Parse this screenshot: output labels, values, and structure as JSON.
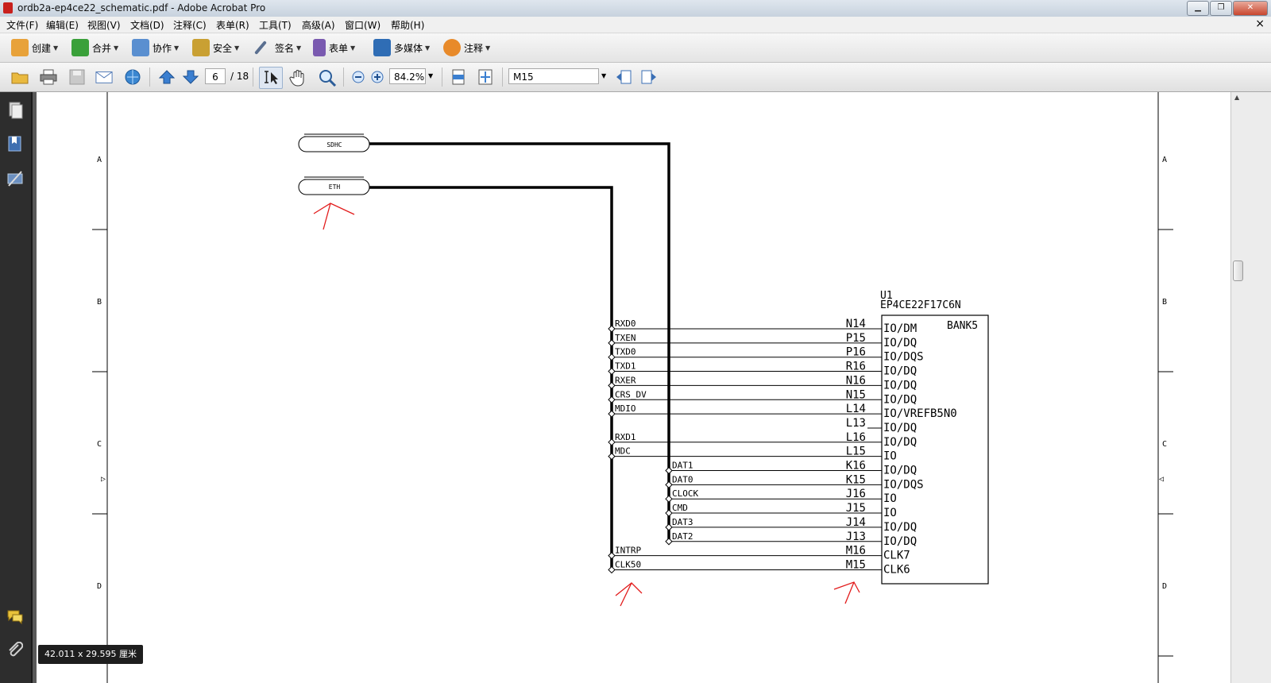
{
  "window": {
    "title": "ordb2a-ep4ce22_schematic.pdf - Adobe Acrobat Pro",
    "minimize": "▁",
    "maximize": "❐",
    "close": "✕"
  },
  "menu": {
    "items": [
      "文件(F)",
      "编辑(E)",
      "视图(V)",
      "文档(D)",
      "注释(C)",
      "表单(R)",
      "工具(T)",
      "高级(A)",
      "窗口(W)",
      "帮助(H)"
    ],
    "doc_close": "×"
  },
  "toolbar1": {
    "buttons": [
      {
        "label": "创建",
        "icon": "create-icon",
        "color": "#e8a23a"
      },
      {
        "label": "合并",
        "icon": "combine-icon",
        "color": "#3aa03a"
      },
      {
        "label": "协作",
        "icon": "collaborate-icon",
        "color": "#5a8fd0"
      },
      {
        "label": "安全",
        "icon": "lock-icon",
        "color": "#c9a033"
      },
      {
        "label": "签名",
        "icon": "pen-icon",
        "color": "#5a6f90"
      },
      {
        "label": "表单",
        "icon": "form-icon",
        "color": "#7a5ab0"
      },
      {
        "label": "多媒体",
        "icon": "multimedia-icon",
        "color": "#2f6db5"
      },
      {
        "label": "注释",
        "icon": "comment-icon",
        "color": "#e88a2a"
      }
    ]
  },
  "toolbar2": {
    "page_current": "6",
    "page_total": "/ 18",
    "zoom": "84.2%",
    "search_value": "M15"
  },
  "status": {
    "page_size": "42.011 x 29.595 厘米"
  },
  "schematic": {
    "row_markers": [
      "A",
      "B",
      "C",
      "D"
    ],
    "connectors": {
      "top": "SDHC",
      "bottom": "ETH"
    },
    "chip": {
      "ref": "U1",
      "part": "EP4CE22F17C6N",
      "bank": "BANK5",
      "pins": [
        {
          "net": "RXD0",
          "ball": "N14",
          "func": "IO/DM"
        },
        {
          "net": "TXEN",
          "ball": "P15",
          "func": "IO/DQ"
        },
        {
          "net": "TXD0",
          "ball": "P16",
          "func": "IO/DQS"
        },
        {
          "net": "TXD1",
          "ball": "R16",
          "func": "IO/DQ"
        },
        {
          "net": "RXER",
          "ball": "N16",
          "func": "IO/DQ"
        },
        {
          "net": "CRS_DV",
          "ball": "N15",
          "func": "IO/DQ"
        },
        {
          "net": "MDIO",
          "ball": "L14",
          "func": "IO/VREFB5N0"
        },
        {
          "net": "",
          "ball": "L13",
          "func": "IO/DQ"
        },
        {
          "net": "RXD1",
          "ball": "L16",
          "func": "IO/DQ"
        },
        {
          "net": "MDC",
          "ball": "L15",
          "func": "IO"
        },
        {
          "net": "DAT1",
          "ball": "K16",
          "func": "IO/DQ"
        },
        {
          "net": "DAT0",
          "ball": "K15",
          "func": "IO/DQS"
        },
        {
          "net": "CLOCK",
          "ball": "J16",
          "func": "IO"
        },
        {
          "net": "CMD",
          "ball": "J15",
          "func": "IO"
        },
        {
          "net": "DAT3",
          "ball": "J14",
          "func": "IO/DQ"
        },
        {
          "net": "DAT2",
          "ball": "J13",
          "func": "IO/DQ"
        },
        {
          "net": "INTRP",
          "ball": "M16",
          "func": "CLK7"
        },
        {
          "net": "CLK50",
          "ball": "M15",
          "func": "CLK6"
        }
      ]
    }
  }
}
